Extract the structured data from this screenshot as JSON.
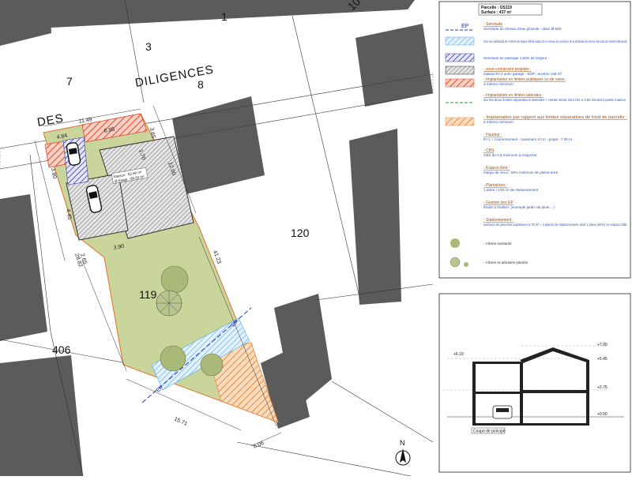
{
  "plan": {
    "streets": {
      "des": "DES",
      "diligences": "DILIGENCES"
    },
    "parcel_numbers": {
      "p1": "1",
      "p3": "3",
      "p7": "7",
      "p8": "8",
      "p10": "10",
      "p119": "119",
      "p120": "120",
      "p406": "406"
    },
    "dimensions": {
      "front": "11.49",
      "front_a": "4.84",
      "front_b": "6.95",
      "side_top": "3.65",
      "left_a": "3.80",
      "left_b": "4.45",
      "left_c": "28.82",
      "right_long": "41.23",
      "inner_depth": "12.00",
      "inner_w": "3.90",
      "small_a": "2.65",
      "small_b": "1.70",
      "bottom": "15.71",
      "bottom_r": "6.06"
    },
    "house_labels": {
      "l1": "Maison : 82.60 m²",
      "l2": "Ø Etage : 66.50 m²"
    },
    "ep_label": "EP",
    "north": "N"
  },
  "legend": {
    "parcel_line1": "Parcelle : OS119",
    "parcel_line2": "Surface : 437 m²",
    "items": [
      {
        "title": "- Servitude",
        "text": "Servitude de réseau d'eau pluviale - diam Ø 500"
      },
      {
        "title": "",
        "text": "zone non aedificandi de 3 mètres de largeur definie autour de ce reseau (en prévision de la demande du service des eaux de Nantes Métropole)"
      },
      {
        "title": "",
        "text": "Servitude de passage 1,50m de largeur"
      },
      {
        "title": "- zone constructe projetée :",
        "text": "maison R+1 avec garage - SDP : environ 149 m²"
      },
      {
        "title": "- Implantation en limites publiques ou de voies:",
        "text": "3 mètres minimum"
      },
      {
        "title": "- Implantation en limites latérales :",
        "text": "sur les deux limites séparatives latérales + retrait retrait mini H/2 ≥ 3.50 minimim partie maison"
      },
      {
        "title": "- Implantation par rapport aux limites séparatives de fond de parcelle :",
        "text": "8 mètres minimum"
      },
      {
        "title": "- Hauteur :",
        "text": "R+1 + couronnement - maximum 10 m - projet : 7.00 m"
      },
      {
        "title": "- CBS",
        "text": "CBS de 0,5 minimum à respecter."
      },
      {
        "title": "- Espace libre :",
        "text": "marge de recul : 50% minimum de pleine terre."
      },
      {
        "title": "- Plantations :",
        "text": "1 arbre / 100 m² de stationnement"
      },
      {
        "title": "- Gestion des EP",
        "text": "Etude à réaliser. (exemple jardin de pluie,...)"
      },
      {
        "title": "- Stationnement :",
        "text": "surfaces de plancher supérieure à 75 m² = 2 places de stationnement dont 1 place (50%) en espace bâti."
      },
      {
        "title": "",
        "text": "- Arbres existants"
      },
      {
        "title": "",
        "text": "- Arbres et arbustes plantés"
      }
    ],
    "ep_symbol": "EP"
  },
  "section": {
    "title": "Coupe de principe",
    "levels": {
      "l700": "+7.00",
      "l610": "+6.10",
      "l545": "+5.45",
      "l275": "+2.75",
      "l000": "+0.00"
    }
  },
  "colors": {
    "lawn": "#c9d59a",
    "hatch_red": "#e04a2a",
    "hatch_orange": "#f08a3c",
    "hatch_blue": "#55a6e6",
    "buildings": "#5a5a5a",
    "ep_line": "#2233cc"
  }
}
